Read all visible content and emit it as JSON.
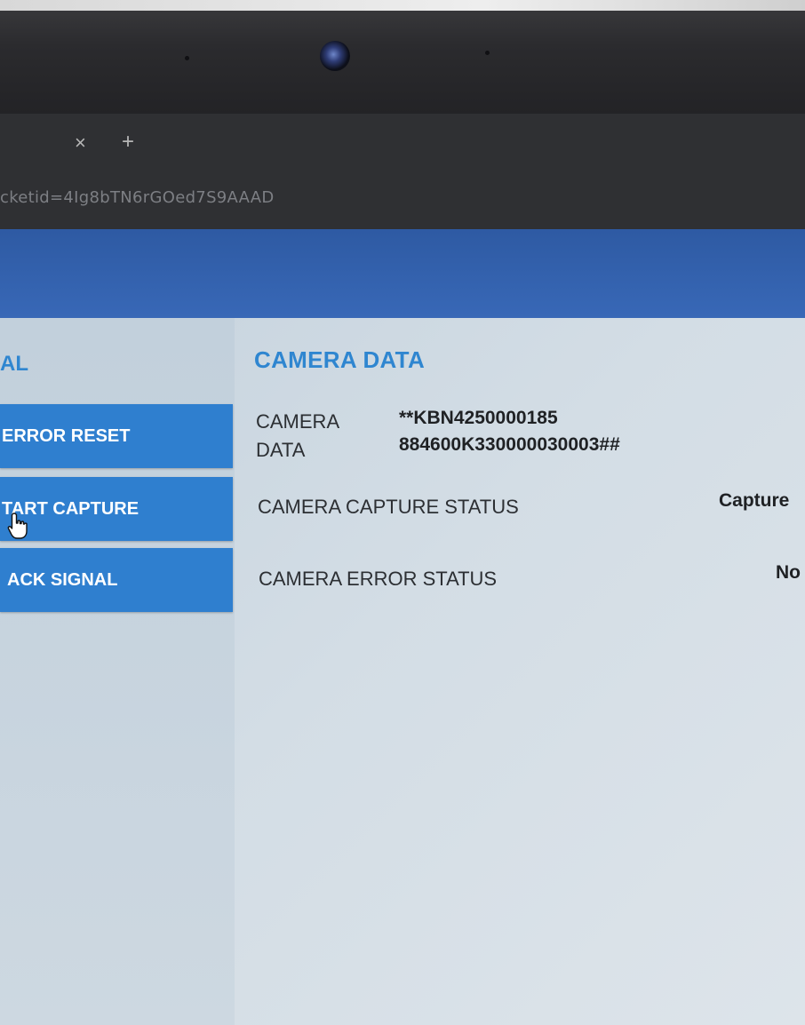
{
  "browser": {
    "tab_close_glyph": "×",
    "new_tab_glyph": "+",
    "url": "cketid=4Ig8bTN6rGOed7S9AAAD"
  },
  "left_panel": {
    "title": "AL",
    "buttons": [
      {
        "label": "ERROR RESET"
      },
      {
        "label": "TART CAPTURE"
      },
      {
        "label": "ACK SIGNAL"
      }
    ]
  },
  "camera": {
    "title": "CAMERA DATA",
    "data_label_line1": "CAMERA",
    "data_label_line2": "DATA",
    "data_value_line1": "**KBN4250000185",
    "data_value_line2": "884600K330000030003##",
    "capture_status_label": "CAMERA CAPTURE STATUS",
    "capture_status_value": "Capture",
    "error_status_label": "CAMERA ERROR STATUS",
    "error_status_value": "No"
  },
  "colors": {
    "header_blue": "#3366b1",
    "button_blue": "#2f7fcf",
    "title_blue": "#2f86d0"
  },
  "icons": [
    "webcam-icon",
    "close-icon",
    "plus-icon",
    "hand-pointer-icon"
  ]
}
